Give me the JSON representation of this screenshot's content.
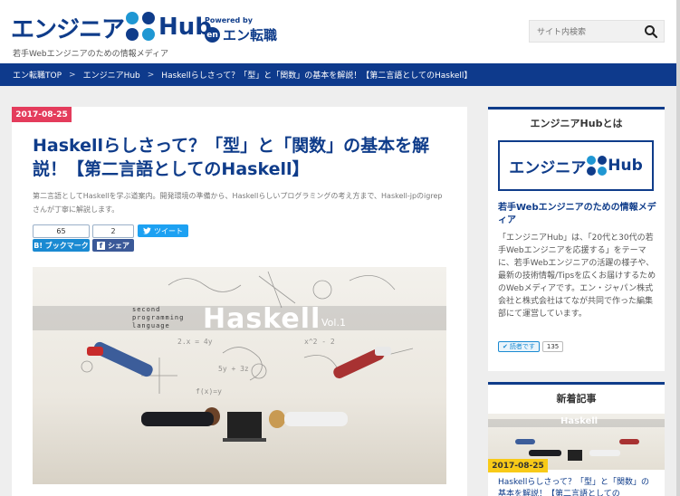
{
  "header": {
    "logo_text": "エンジニア",
    "logo_hub": "Hub",
    "powered_by": "Powered by",
    "en_mark": "en",
    "en_text": "エン転職",
    "tagline": "若手Webエンジニアのための情報メディア"
  },
  "search": {
    "placeholder": "サイト内検索",
    "icon": "search-icon"
  },
  "breadcrumb": {
    "items": [
      "エン転職TOP",
      "エンジニアHub",
      "Haskellらしさって？「型」と「関数」の基本を解説！【第二言語としてのHaskell】"
    ],
    "separator": ">"
  },
  "article": {
    "date": "2017-08-25",
    "title": "Haskellらしさって？「型」と「関数」の基本を解説！【第二言語としてのHaskell】",
    "description": "第二言語としてHaskellを学ぶ道案内。開発環境の準備から、Haskellらしいプログラミングの考え方まで、Haskell-jpのigrepさんが丁寧に解説します。",
    "share": {
      "hatena_count": "65",
      "hatena_label": "ブックマーク",
      "hatena_icon_text": "B!",
      "facebook_count": "2",
      "facebook_label": "シェア",
      "tweet_label": "ツイート"
    },
    "hero": {
      "subtitle_lines": [
        "second",
        "programming",
        "language"
      ],
      "title": "Haskell",
      "vol": "Vol.1"
    }
  },
  "sidebar": {
    "about": {
      "heading": "エンジニアHubとは",
      "logo_text": "エンジニア",
      "logo_hub": "Hub",
      "subheading": "若手Webエンジニアのための情報メディア",
      "body": "「エンジニアHub」は、「20代と30代の若手Webエンジニアを応援する」をテーマに、若手Webエンジニアの活躍の様子や、最新の技術情報/Tipsを広くお届けするためのWebメディアです。エン・ジャパン株式会社と株式会社はてなが共同で作った編集部にて運営しています。",
      "follow_label": "読者です",
      "follow_count": "135"
    },
    "new_articles": {
      "heading": "新着記事",
      "thumb_title": "Haskell",
      "date": "2017-08-25",
      "title": "Haskellらしさって？「型」と「関数」の基本を解説！【第二言語としての"
    }
  },
  "colors": {
    "brand": "#0f3c8a",
    "accent": "#1f97d3",
    "date_badge": "#e43c5c",
    "new_date_badge": "#f8ca18"
  }
}
